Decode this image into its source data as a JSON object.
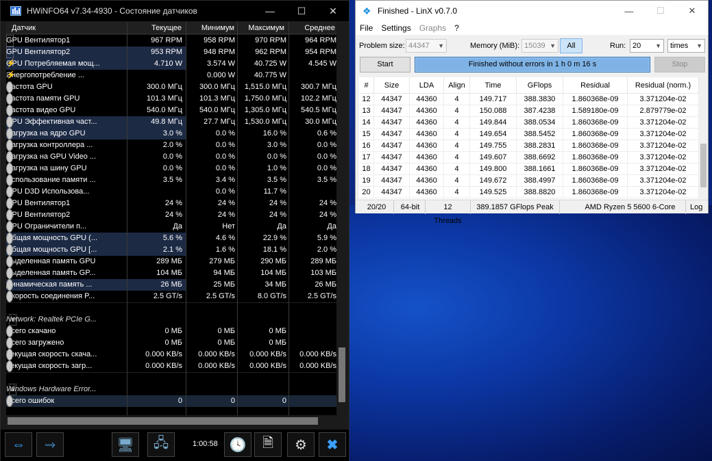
{
  "hwinfo": {
    "title": "HWiNFO64 v7.34-4930 - Состояние датчиков",
    "columns": [
      "Датчик",
      "Текущее",
      "Минимум",
      "Максимум",
      "Среднее"
    ],
    "rows": [
      {
        "icon": "chip",
        "label": "GPU Вентилятор1",
        "cur": "967 RPM",
        "min": "958 RPM",
        "max": "970 RPM",
        "avg": "964 RPM"
      },
      {
        "icon": "chip",
        "label": "GPU Вентилятор2",
        "cur": "953 RPM",
        "min": "948 RPM",
        "max": "962 RPM",
        "avg": "954 RPM",
        "hl": true
      },
      {
        "icon": "bolt",
        "label": "GPU Потребляемая мощ...",
        "cur": "4.710 W",
        "min": "3.574 W",
        "max": "40.725 W",
        "avg": "4.545 W",
        "hl": true
      },
      {
        "icon": "bolt",
        "label": "Энергопотребление ...",
        "cur": "",
        "min": "0.000 W",
        "max": "40.775 W",
        "avg": "",
        "expand": true
      },
      {
        "icon": "clock",
        "label": "Частота GPU",
        "cur": "300.0 МГц",
        "min": "300.0 МГц",
        "max": "1,515.0 МГц",
        "avg": "300.7 МГц"
      },
      {
        "icon": "clock",
        "label": "Частота памяти GPU",
        "cur": "101.3 МГц",
        "min": "101.3 МГц",
        "max": "1,750.0 МГц",
        "avg": "102.2 МГц"
      },
      {
        "icon": "clock",
        "label": "Частота видео GPU",
        "cur": "540.0 МГц",
        "min": "540.0 МГц",
        "max": "1,305.0 МГц",
        "avg": "540.5 МГц"
      },
      {
        "icon": "clock",
        "label": "GPU Эффективная част...",
        "cur": "49.8 МГц",
        "min": "27.7 МГц",
        "max": "1,530.0 МГц",
        "avg": "30.0 МГц",
        "hl": true
      },
      {
        "icon": "clock",
        "label": "Нагрузка на ядро GPU",
        "cur": "3.0 %",
        "min": "0.0 %",
        "max": "16.0 %",
        "avg": "0.6 %",
        "hl": true
      },
      {
        "icon": "clock",
        "label": "Нагрузка контроллера ...",
        "cur": "2.0 %",
        "min": "0.0 %",
        "max": "3.0 %",
        "avg": "0.0 %"
      },
      {
        "icon": "clock",
        "label": "Нагрузка на GPU Video ...",
        "cur": "0.0 %",
        "min": "0.0 %",
        "max": "0.0 %",
        "avg": "0.0 %"
      },
      {
        "icon": "clock",
        "label": "Нагрузка на шину GPU",
        "cur": "0.0 %",
        "min": "0.0 %",
        "max": "1.0 %",
        "avg": "0.0 %"
      },
      {
        "icon": "clock",
        "label": "Использование памяти ...",
        "cur": "3.5 %",
        "min": "3.4 %",
        "max": "3.5 %",
        "avg": "3.5 %"
      },
      {
        "icon": "clock",
        "label": "GPU D3D Использова...",
        "cur": "",
        "min": "0.0 %",
        "max": "11.7 %",
        "avg": "",
        "expand": true
      },
      {
        "icon": "clock",
        "label": "GPU Вентилятор1",
        "cur": "24 %",
        "min": "24 %",
        "max": "24 %",
        "avg": "24 %"
      },
      {
        "icon": "clock",
        "label": "GPU Вентилятор2",
        "cur": "24 %",
        "min": "24 %",
        "max": "24 %",
        "avg": "24 %"
      },
      {
        "icon": "clock",
        "label": "GPU Ограничители п...",
        "cur": "Да",
        "min": "Нет",
        "max": "Да",
        "avg": "Да",
        "expand": true
      },
      {
        "icon": "clock",
        "label": "Общая мощность GPU (...",
        "cur": "5.6 %",
        "min": "4.6 %",
        "max": "22.9 %",
        "avg": "5.9 %",
        "hl": true
      },
      {
        "icon": "clock",
        "label": "Общая мощность GPU [...",
        "cur": "2.1 %",
        "min": "1.6 %",
        "max": "18.1 %",
        "avg": "2.0 %",
        "hl": true
      },
      {
        "icon": "clock",
        "label": "Выделенная память GPU",
        "cur": "289 МБ",
        "min": "279 МБ",
        "max": "290 МБ",
        "avg": "289 МБ"
      },
      {
        "icon": "clock",
        "label": "Выделенная память GP...",
        "cur": "104 МБ",
        "min": "94 МБ",
        "max": "104 МБ",
        "avg": "103 МБ"
      },
      {
        "icon": "clock",
        "label": "Динамическая память ...",
        "cur": "26 МБ",
        "min": "25 МБ",
        "max": "34 МБ",
        "avg": "26 МБ",
        "hl": true
      },
      {
        "icon": "clock",
        "label": "Скорость соединения P...",
        "cur": "2.5 GT/s",
        "min": "2.5 GT/s",
        "max": "8.0 GT/s",
        "avg": "2.5 GT/s"
      },
      {
        "sep": true
      },
      {
        "group": true,
        "label": "Network: Realtek PCIe G..."
      },
      {
        "icon": "clock",
        "label": "Всего скачано",
        "cur": "0 МБ",
        "min": "0 МБ",
        "max": "0 МБ",
        "avg": ""
      },
      {
        "icon": "clock",
        "label": "Всего загружено",
        "cur": "0 МБ",
        "min": "0 МБ",
        "max": "0 МБ",
        "avg": ""
      },
      {
        "icon": "clock",
        "label": "Текущая скорость скача...",
        "cur": "0.000 KB/s",
        "min": "0.000 KB/s",
        "max": "0.000 KB/s",
        "avg": "0.000 KB/s"
      },
      {
        "icon": "clock",
        "label": "Текущая скорость загр...",
        "cur": "0.000 KB/s",
        "min": "0.000 KB/s",
        "max": "0.000 KB/s",
        "avg": "0.000 KB/s"
      },
      {
        "sep": true
      },
      {
        "group": true,
        "label": "Windows Hardware Error..."
      },
      {
        "icon": "clock",
        "label": "Всего ошибок",
        "cur": "0",
        "min": "0",
        "max": "0",
        "avg": "",
        "sel": true
      }
    ],
    "timer": "1:00:58"
  },
  "linx": {
    "title": "Finished - LinX v0.7.0",
    "menu": [
      "File",
      "Settings",
      "Graphs",
      "?"
    ],
    "problem_size_label": "Problem size:",
    "problem_size": "44347",
    "memory_label": "Memory (MiB):",
    "memory": "15039",
    "all_label": "All",
    "run_label": "Run:",
    "run": "20",
    "run_unit": "times",
    "start_label": "Start",
    "status": "Finished without errors in 1 h 0 m 16 s",
    "stop_label": "Stop",
    "columns": [
      "#",
      "Size",
      "LDA",
      "Align",
      "Time",
      "GFlops",
      "Residual",
      "Residual (norm.)"
    ],
    "rows": [
      [
        "12",
        "44347",
        "44360",
        "4",
        "149.717",
        "388.3830",
        "1.860368e-09",
        "3.371204e-02"
      ],
      [
        "13",
        "44347",
        "44360",
        "4",
        "150.088",
        "387.4238",
        "1.589180e-09",
        "2.879779e-02"
      ],
      [
        "14",
        "44347",
        "44360",
        "4",
        "149.844",
        "388.0534",
        "1.860368e-09",
        "3.371204e-02"
      ],
      [
        "15",
        "44347",
        "44360",
        "4",
        "149.654",
        "388.5452",
        "1.860368e-09",
        "3.371204e-02"
      ],
      [
        "16",
        "44347",
        "44360",
        "4",
        "149.755",
        "388.2831",
        "1.860368e-09",
        "3.371204e-02"
      ],
      [
        "17",
        "44347",
        "44360",
        "4",
        "149.607",
        "388.6692",
        "1.860368e-09",
        "3.371204e-02"
      ],
      [
        "18",
        "44347",
        "44360",
        "4",
        "149.800",
        "388.1661",
        "1.860368e-09",
        "3.371204e-02"
      ],
      [
        "19",
        "44347",
        "44360",
        "4",
        "149.672",
        "388.4997",
        "1.860368e-09",
        "3.371204e-02"
      ],
      [
        "20",
        "44347",
        "44360",
        "4",
        "149.525",
        "388.8820",
        "1.860368e-09",
        "3.371204e-02"
      ]
    ],
    "footer": {
      "progress": "20/20",
      "bits": "64-bit",
      "threads": "12 Threads",
      "peak": "389.1857 GFlops Peak",
      "cpu": "AMD Ryzen 5 5600 6-Core",
      "log": "Log"
    }
  }
}
